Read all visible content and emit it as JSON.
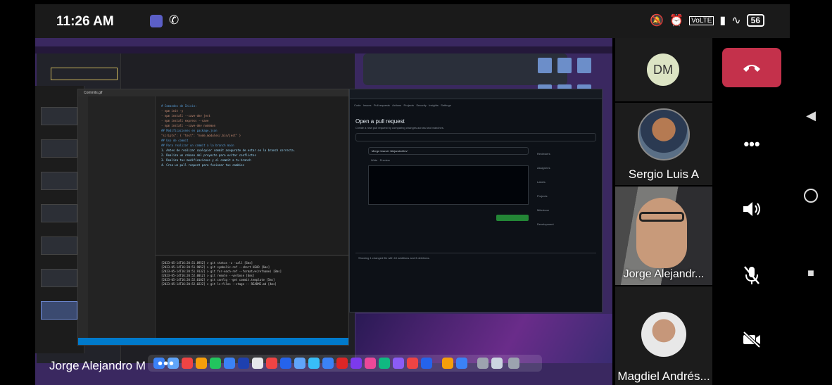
{
  "status_bar": {
    "time": "11:26 AM",
    "teams_icon": "teams-icon",
    "call_icon": "phone-call-icon",
    "right_icons": [
      "mute-notifications-icon",
      "alarm-icon",
      "volte-icon",
      "signal-icon",
      "wifi-icon"
    ],
    "battery": "56"
  },
  "shared_screen": {
    "presenter_name": "Jorge Alejandro M",
    "more_label": "•••",
    "vscode_window_title": "Commits.gif",
    "editor_lines": [
      "# Comandos de Inicio:",
      "- npm init -y",
      "- npm install --save-dev jest",
      "- npm install express --save",
      "- npm install --save-dev nodemon",
      "## Modificaciones en package.json",
      "\"scripts\": { \"test\": \"node_modules/.bin/jest\" }",
      "## Uso de commit",
      "## Para realizar un commit a la branch main",
      "1. Antes de realizar cualquier commit asegurate de estar en la branch correcta.",
      "2. Realiza un rebase del proyecto para evitar conflictos",
      "3. Realiza tus modificaciones y el commit a tu branch",
      "4. Crea un pull request para fusionar tus cambios"
    ],
    "terminal_lines": [
      "[2023-05-14T16:20:51.895Z] > git status -z -uall [6ms]",
      "[2023-05-14T16:20:51.905Z] > git symbolic-ref --short HEAD [6ms]",
      "[2023-05-14T16:20:51.913Z] > git for-each-ref --format=%(refname) [8ms]",
      "[2023-05-14T16:20:52.001Z] > git remote --verbose [6ms]",
      "[2023-05-14T16:20:52.010Z] > git config --get commit.template [5ms]",
      "[2023-05-14T16:20:52.022Z] > git ls-files --stage -- README.md [4ms]"
    ],
    "github": {
      "tabs": [
        "Code",
        "Issues",
        "Pull requests",
        "Actions",
        "Projects",
        "Security",
        "Insights",
        "Settings"
      ],
      "heading": "Open a pull request",
      "subtitle": "Create a new pull request by comparing changes across two branches.",
      "pr_title": "Merge branch 'AlejandroDev'",
      "write_tab": "Write",
      "preview_tab": "Preview",
      "sidebar_labels": [
        "Reviewers",
        "Assignees",
        "Labels",
        "Projects",
        "Milestone",
        "Development"
      ],
      "diff_summary": "Showing 1 changed file with 10 additions and 3 deletions."
    }
  },
  "participants": [
    {
      "initials": "DM",
      "name": ""
    },
    {
      "name": "Sergio Luis A"
    },
    {
      "name": "Jorge Alejandr..."
    },
    {
      "name": "Magdiel Andrés..."
    }
  ],
  "controls": {
    "hangup": "hangup-icon",
    "more": "•••",
    "speaker": "speaker-icon",
    "mic": "mic-off-icon",
    "camera": "camera-off-icon"
  },
  "android_nav": {
    "back": "◀",
    "home": "●",
    "recents": "■"
  }
}
